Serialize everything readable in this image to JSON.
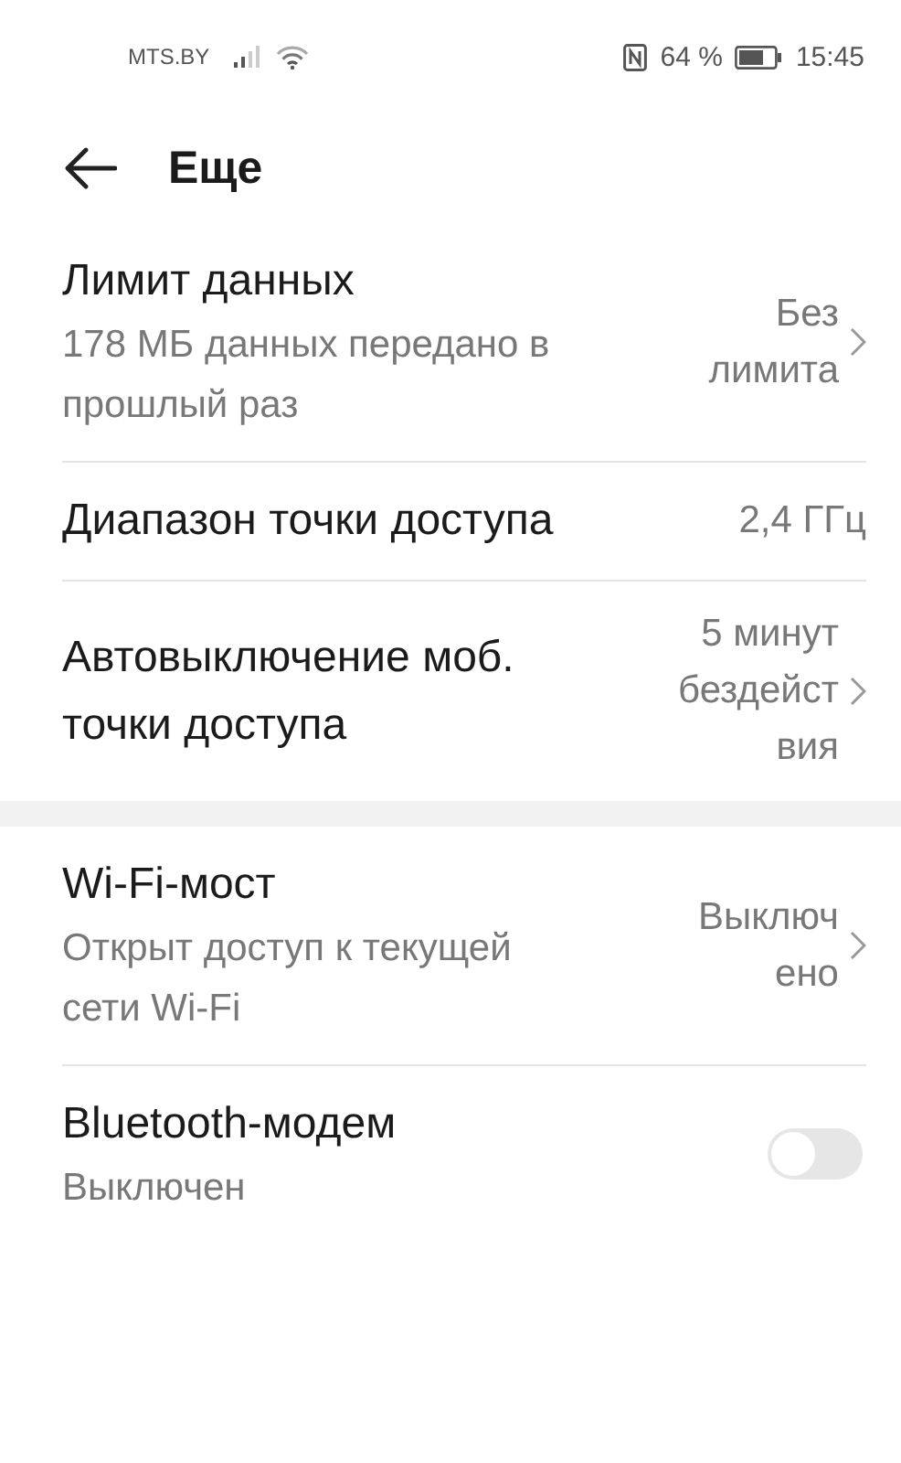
{
  "status_bar": {
    "carrier": "MTS.BY",
    "battery_percent": "64 %",
    "time": "15:45"
  },
  "header": {
    "title": "Еще"
  },
  "sections": [
    {
      "items": [
        {
          "kind": "link",
          "title": "Лимит данных",
          "subtitle": "178 МБ данных передано в прошлый раз",
          "value_lines": [
            "Без",
            "лимита"
          ]
        },
        {
          "kind": "value",
          "title": "Диапазон точки доступа",
          "value_lines": [
            "2,4 ГГц"
          ]
        },
        {
          "kind": "link",
          "title": "Автовыключение моб. точки доступа",
          "value_lines": [
            "5 минут",
            "бездейст",
            "вия"
          ]
        }
      ]
    },
    {
      "items": [
        {
          "kind": "link",
          "title": "Wi-Fi-мост",
          "subtitle": "Открыт доступ к текущей сети Wi-Fi",
          "value_lines": [
            "Выключ",
            "ено"
          ]
        },
        {
          "kind": "toggle",
          "title": "Bluetooth-модем",
          "subtitle": "Выключен",
          "on": false
        }
      ]
    }
  ]
}
